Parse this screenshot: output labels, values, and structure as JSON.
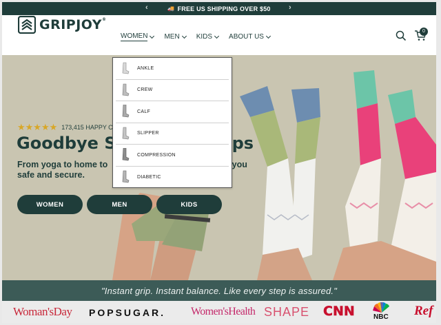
{
  "announcement": {
    "text": "FREE US SHIPPING OVER $50",
    "prev": "‹",
    "next": "›"
  },
  "brand": {
    "name": "GRIPJOY",
    "reg": "®"
  },
  "nav": [
    {
      "label": "WOMEN"
    },
    {
      "label": "MEN"
    },
    {
      "label": "KIDS"
    },
    {
      "label": "ABOUT US"
    }
  ],
  "cart": {
    "count": "0"
  },
  "hero": {
    "stars": "★★★★★",
    "reviews": "173,415 HAPPY C",
    "headline_left": "Goodbye S",
    "headline_right": "ps",
    "sub_line1_left": "From yoga to home to",
    "sub_line1_right": "s you",
    "sub_line2": "safe and secure.",
    "buttons": [
      {
        "label": "WOMEN"
      },
      {
        "label": "MEN"
      },
      {
        "label": "KIDS"
      }
    ]
  },
  "dropdown": {
    "items": [
      {
        "label": "ANKLE"
      },
      {
        "label": "CREW"
      },
      {
        "label": "CALF"
      },
      {
        "label": "SLIPPER"
      },
      {
        "label": "COMPRESSION"
      },
      {
        "label": "DIABETIC"
      }
    ]
  },
  "quote": "\"Instant grip. Instant balance. Like every step is assured.\"",
  "press": {
    "womansday": "Woman'sDay",
    "popsugar": "POPSUGAR.",
    "womenshealth": "Women'sHealth",
    "shape": "SHAPE",
    "cnn": "CNN",
    "nbc": "NBC",
    "refinery": "Ref"
  },
  "colors": {
    "brand": "#1f3d3a",
    "hero_bg": "#c9c5b1",
    "star": "#d8a727",
    "quote_bar": "#3c5b57"
  }
}
